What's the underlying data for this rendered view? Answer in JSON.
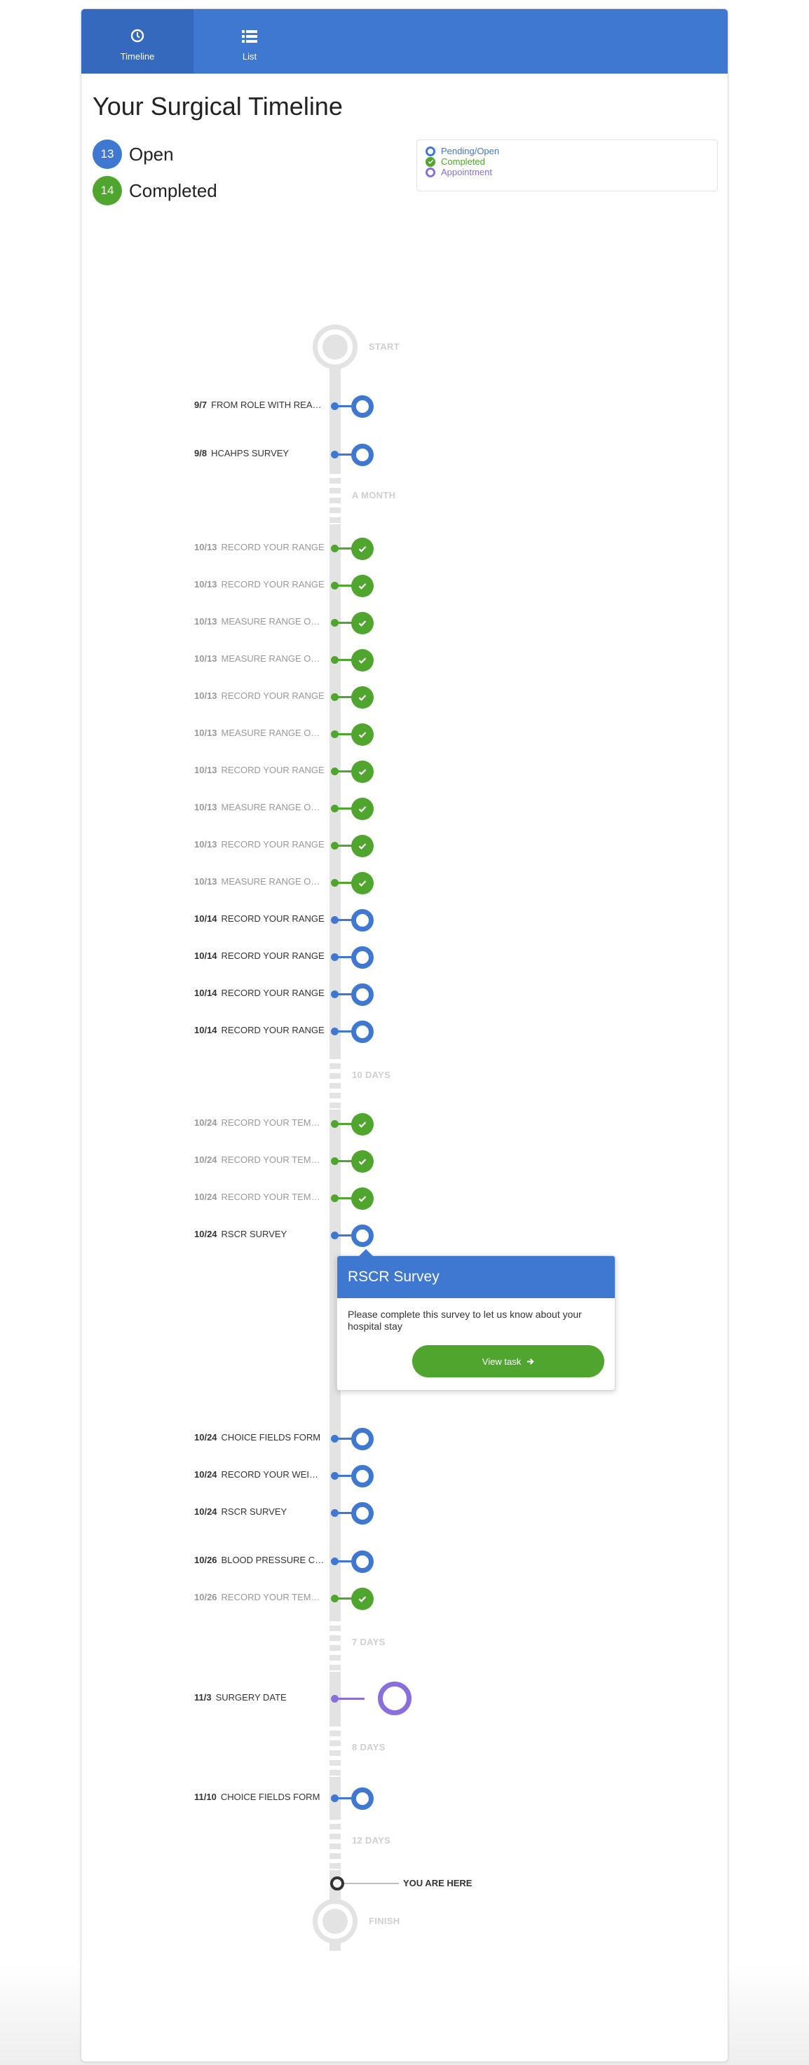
{
  "colors": {
    "primary": "#3f78d0",
    "completed": "#4fa52e",
    "appointment": "#8a6fdc",
    "rail": "#e3e3e3"
  },
  "tabs": [
    {
      "label": "Timeline",
      "icon": "clock-icon",
      "active": true
    },
    {
      "label": "List",
      "icon": "list-icon",
      "active": false
    }
  ],
  "page_title": "Your Surgical Timeline",
  "counts": {
    "open": {
      "value": "13",
      "label": "Open"
    },
    "completed": {
      "value": "14",
      "label": "Completed"
    }
  },
  "legend": [
    {
      "label": "Pending/Open",
      "type": "open"
    },
    {
      "label": "Completed",
      "type": "done"
    },
    {
      "label": "Appointment",
      "type": "appt"
    }
  ],
  "milestones": {
    "start": "START",
    "month": "A MONTH",
    "ten_days": "10 DAYS",
    "seven_days": "7 DAYS",
    "eight_days": "8 DAYS",
    "twelve_days": "12 DAYS",
    "finish": "FINISH",
    "you_are_here": "YOU ARE HERE"
  },
  "events": [
    {
      "date": "9/7",
      "title": "FROM ROLE WITH REACH",
      "status": "open"
    },
    {
      "date": "9/8",
      "title": "HCAHPS SURVEY",
      "status": "open"
    },
    {
      "date": "10/13",
      "title": "RECORD YOUR RANGE",
      "status": "done"
    },
    {
      "date": "10/13",
      "title": "RECORD YOUR RANGE",
      "status": "done"
    },
    {
      "date": "10/13",
      "title": "MEASURE RANGE OF MOTION",
      "status": "done"
    },
    {
      "date": "10/13",
      "title": "MEASURE RANGE OF MOTION",
      "status": "done"
    },
    {
      "date": "10/13",
      "title": "RECORD YOUR RANGE",
      "status": "done"
    },
    {
      "date": "10/13",
      "title": "MEASURE RANGE OF MOTION",
      "status": "done"
    },
    {
      "date": "10/13",
      "title": "RECORD YOUR RANGE",
      "status": "done"
    },
    {
      "date": "10/13",
      "title": "MEASURE RANGE OF MOTION",
      "status": "done"
    },
    {
      "date": "10/13",
      "title": "RECORD YOUR RANGE",
      "status": "done"
    },
    {
      "date": "10/13",
      "title": "MEASURE RANGE OF MOTION",
      "status": "done"
    },
    {
      "date": "10/14",
      "title": "RECORD YOUR RANGE",
      "status": "open"
    },
    {
      "date": "10/14",
      "title": "RECORD YOUR RANGE",
      "status": "open"
    },
    {
      "date": "10/14",
      "title": "RECORD YOUR RANGE",
      "status": "open"
    },
    {
      "date": "10/14",
      "title": "RECORD YOUR RANGE",
      "status": "open"
    },
    {
      "date": "10/24",
      "title": "RECORD YOUR TEMPERATURE",
      "status": "done"
    },
    {
      "date": "10/24",
      "title": "RECORD YOUR TEMPERATURE",
      "status": "done"
    },
    {
      "date": "10/24",
      "title": "RECORD YOUR TEMPERATURE",
      "status": "done"
    },
    {
      "date": "10/24",
      "title": "RSCR SURVEY",
      "status": "open"
    },
    {
      "date": "10/24",
      "title": "CHOICE FIELDS FORM",
      "status": "open"
    },
    {
      "date": "10/24",
      "title": "RECORD YOUR WEIGHT",
      "status": "open"
    },
    {
      "date": "10/24",
      "title": "RSCR SURVEY",
      "status": "open"
    },
    {
      "date": "10/26",
      "title": "BLOOD PRESSURE CHECK",
      "status": "open"
    },
    {
      "date": "10/26",
      "title": "RECORD YOUR TEMPERATURE",
      "status": "done"
    },
    {
      "date": "11/3",
      "title": "SURGERY DATE",
      "status": "appt"
    },
    {
      "date": "11/10",
      "title": "CHOICE FIELDS FORM",
      "status": "open"
    }
  ],
  "popup": {
    "title": "RSCR Survey",
    "body": "Please complete this survey to let us know about your hospital stay",
    "button": "View task"
  }
}
